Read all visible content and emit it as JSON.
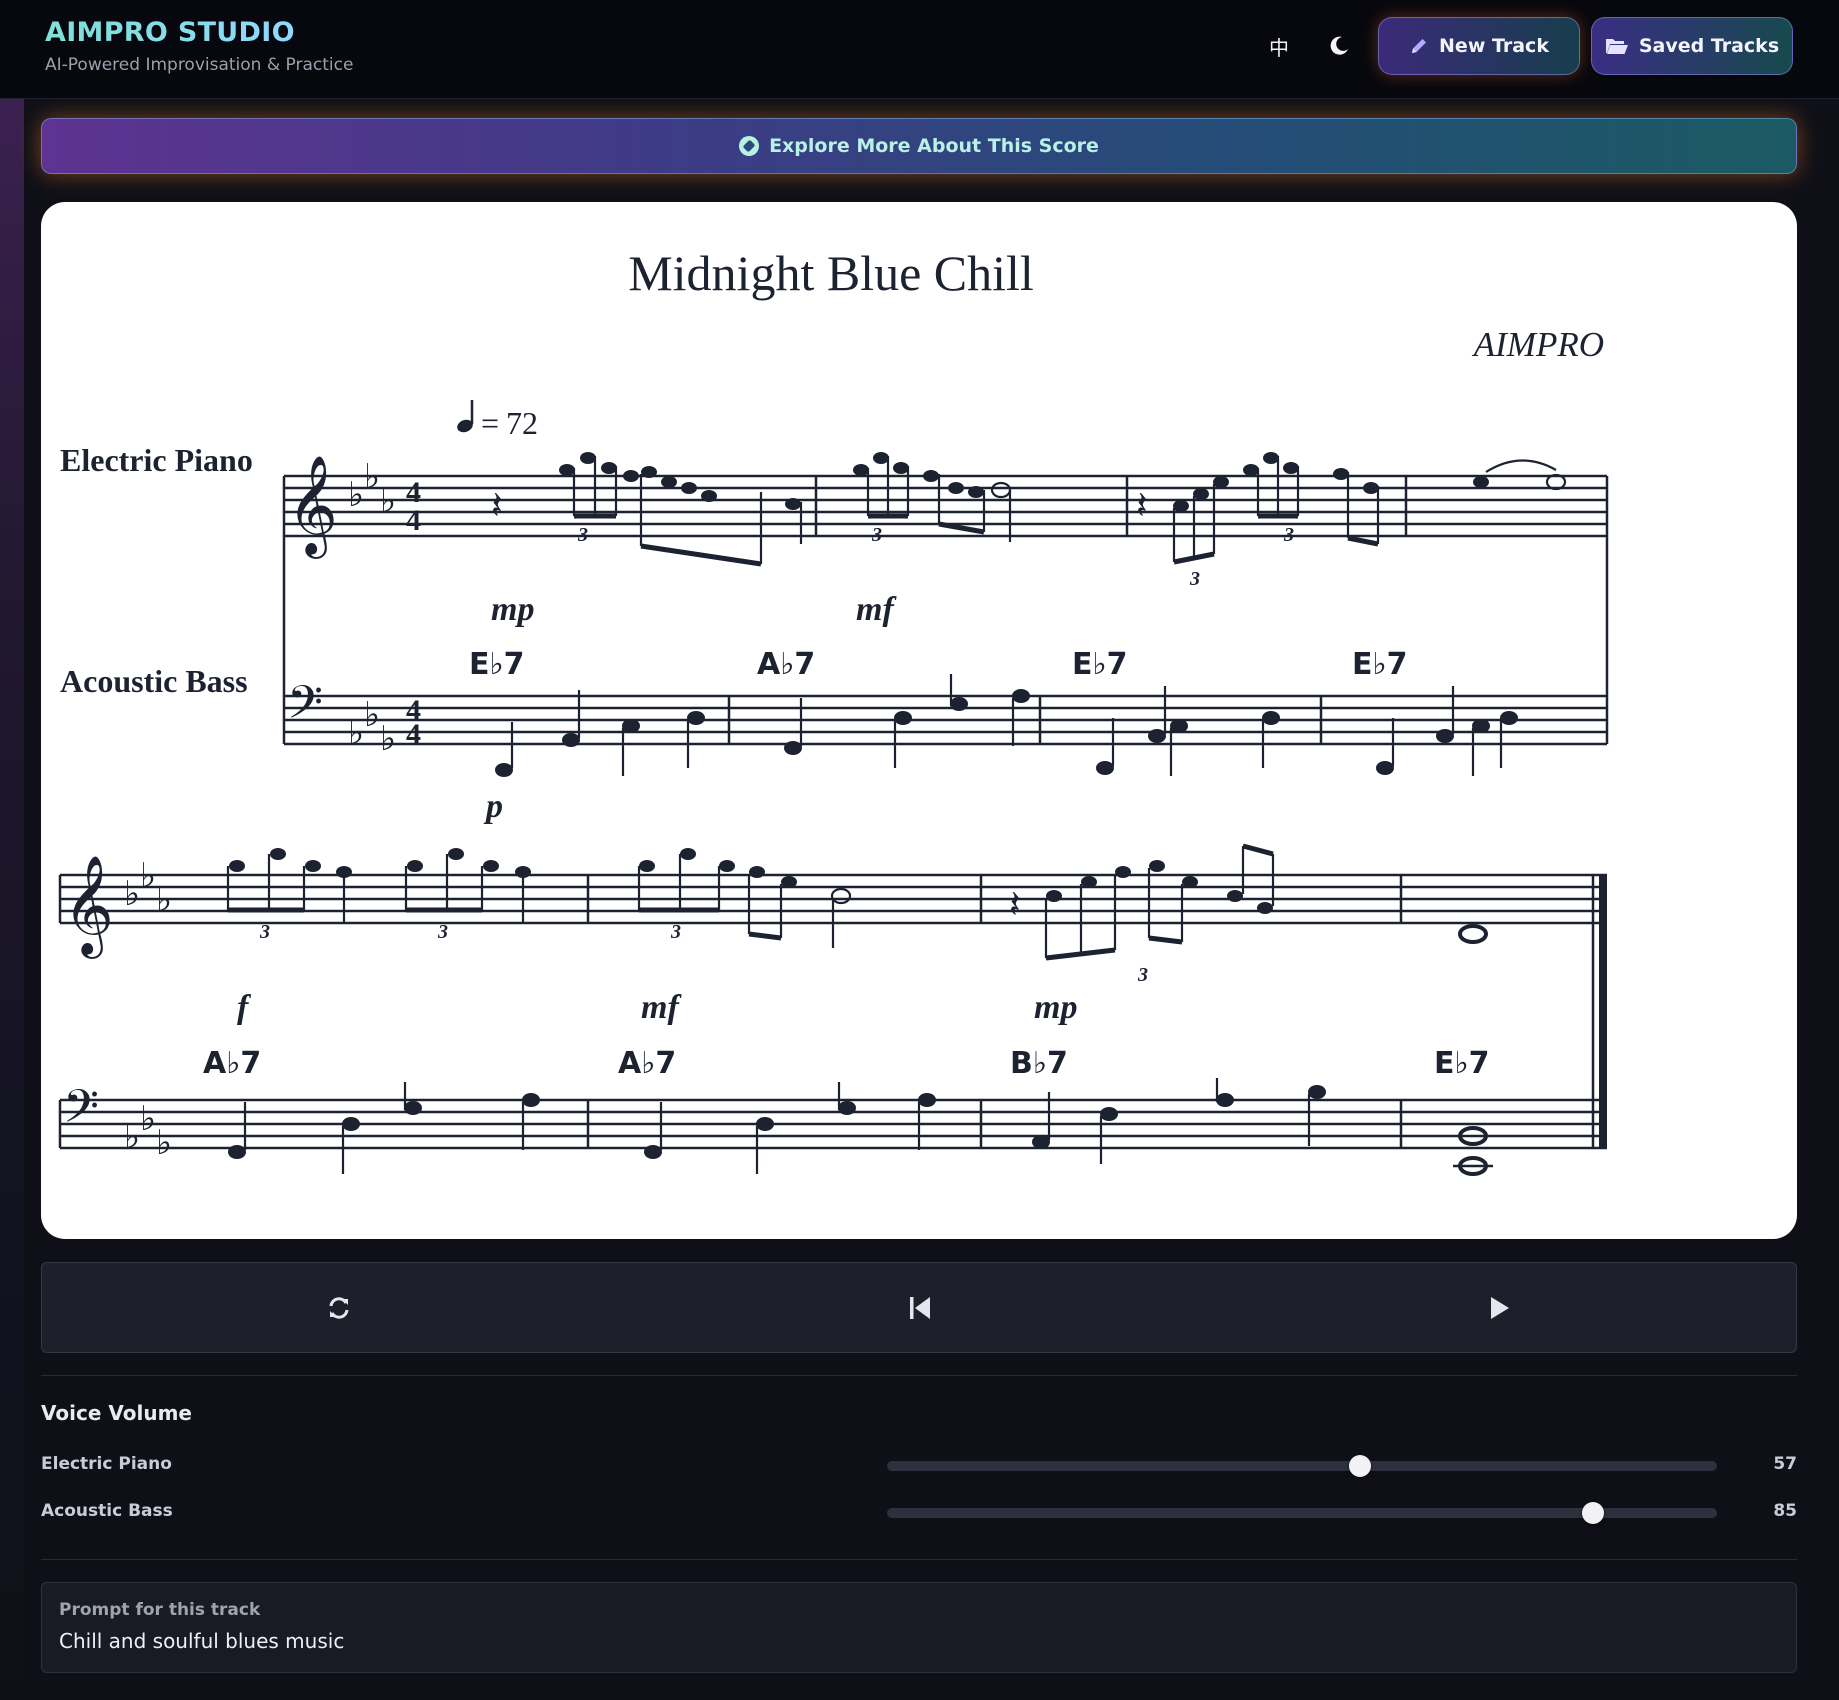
{
  "header": {
    "title": "AIMPRO STUDIO",
    "subtitle": "AI-Powered Improvisation & Practice",
    "language_toggle": "中",
    "theme_icon": "moon-icon",
    "new_track_label": "New Track",
    "saved_tracks_label": "Saved Tracks"
  },
  "explore": {
    "label": "Explore More About This Score",
    "icon": "compass-icon"
  },
  "score": {
    "title": "Midnight Blue Chill",
    "composer": "AIMPRO",
    "tempo_value": "72",
    "key_signature": "E♭ major (3 flats)",
    "time_signature": "4/4",
    "instruments": [
      "Electric Piano",
      "Acoustic Bass"
    ],
    "system1": {
      "dynamics": [
        "mp",
        "mf"
      ],
      "bass_dynamic": "p",
      "chords": [
        "E♭7",
        "A♭7",
        "E♭7",
        "E♭7"
      ]
    },
    "system2": {
      "dynamics": [
        "f",
        "mf",
        "mp"
      ],
      "chords": [
        "A♭7",
        "A♭7",
        "B♭7",
        "E♭7"
      ]
    },
    "triplet_mark": "3"
  },
  "transport": {
    "loop_icon": "loop-icon",
    "restart_icon": "skip-back-icon",
    "play_icon": "play-icon"
  },
  "volume": {
    "title": "Voice Volume",
    "voices": [
      {
        "label": "Electric Piano",
        "value": 57
      },
      {
        "label": "Acoustic Bass",
        "value": 85
      }
    ]
  },
  "prompt": {
    "label": "Prompt for this track",
    "text": "Chill and soulful blues music"
  },
  "colors": {
    "accent_teal": "#7fe0d4",
    "banner_purple": "#5e3391",
    "ink": "#1d2230"
  }
}
